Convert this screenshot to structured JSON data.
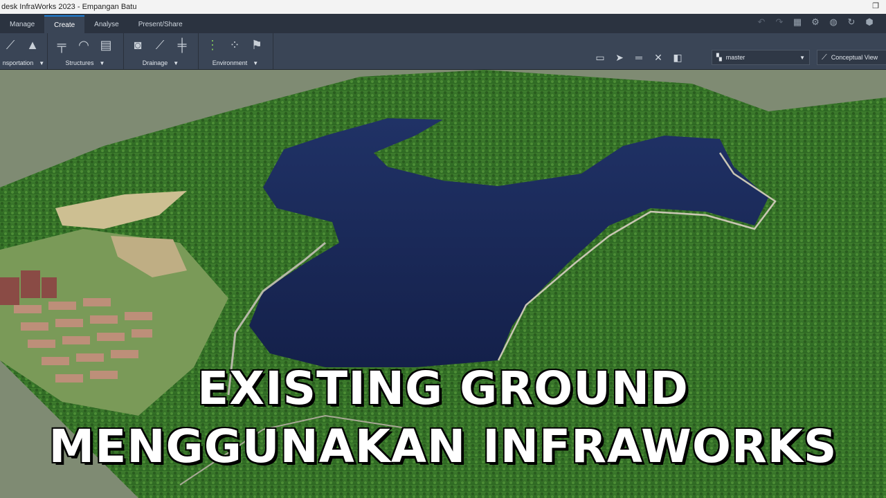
{
  "window": {
    "title": "desk InfraWorks 2023 - Empangan Batu"
  },
  "tabs": [
    {
      "label": "Manage"
    },
    {
      "label": "Create"
    },
    {
      "label": "Analyse"
    },
    {
      "label": "Present/Share"
    }
  ],
  "active_tab": "Create",
  "ribbon": {
    "panels": [
      {
        "label": "nsportation"
      },
      {
        "label": "Structures"
      },
      {
        "label": "Drainage"
      },
      {
        "label": "Environment"
      }
    ]
  },
  "model_dropdown": {
    "value": "master"
  },
  "view_dropdown": {
    "value": "Conceptual View"
  },
  "overlay": {
    "line1": "EXISTING GROUND",
    "line2": "MENGGUNAKAN INFRAWORKS"
  },
  "colors": {
    "ribbon_bg": "#3a4556",
    "tab_bg": "#2b3340",
    "accent": "#1e7fd6",
    "water": "#1b2a55",
    "forest": "#3c7a2c"
  }
}
